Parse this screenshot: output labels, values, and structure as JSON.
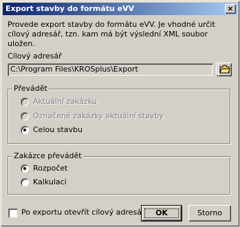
{
  "window": {
    "title": "Export stavby do formátu eVV",
    "close_label": "×"
  },
  "description": "Provede export stavby do formátu eVV. Je vhodné určit cílový adresář, tzn. kam má být výslední XML soubor uložen.",
  "target": {
    "label": "Cílový adresář",
    "path": "C:\\Program Files\\KROSplus\\Export",
    "browse_label": "...",
    "folder_icon": "folder-icon"
  },
  "transfer_group": {
    "title": "Převádět",
    "options": [
      {
        "label": "Aktuální zakázku",
        "selected": false,
        "enabled": false
      },
      {
        "label": "Označené zakázky aktuální stavby",
        "selected": false,
        "enabled": false
      },
      {
        "label": "Celou stavbu",
        "selected": true,
        "enabled": true
      }
    ]
  },
  "orders_group": {
    "title": "Zakázce převádět",
    "options": [
      {
        "label": "Rozpočet",
        "selected": true,
        "enabled": true
      },
      {
        "label": "Kalkulaci",
        "selected": false,
        "enabled": true
      }
    ]
  },
  "open_after": {
    "label": "Po exportu otevřít cílový adresář",
    "checked": false
  },
  "buttons": {
    "ok": "OK",
    "cancel": "Storno"
  },
  "colors": {
    "title_start": "#0a246a",
    "title_end": "#a6caf0",
    "face": "#d4d0c8"
  }
}
